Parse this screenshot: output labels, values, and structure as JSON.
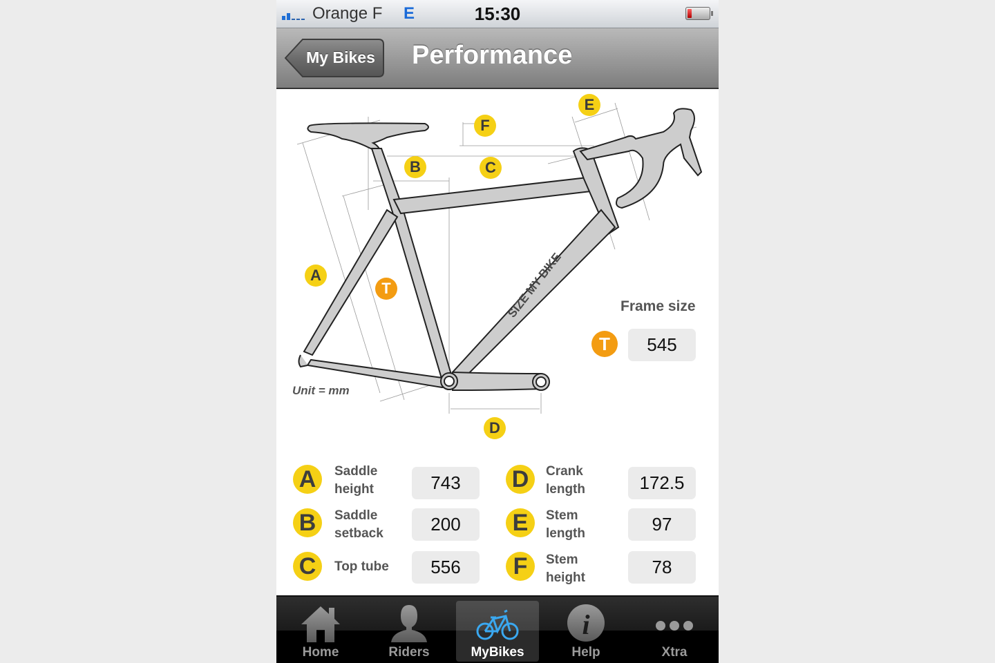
{
  "status_bar": {
    "carrier": "Orange F",
    "network": "E",
    "time": "15:30",
    "signal_bars_active": 2,
    "signal_bars_total": 5,
    "battery_level": 0.2
  },
  "nav": {
    "back_label": "My Bikes",
    "title": "Performance"
  },
  "diagram": {
    "brand_text": "SIZE MY BIKE",
    "unit_label": "Unit = mm",
    "markers": [
      "A",
      "B",
      "C",
      "D",
      "E",
      "F",
      "T"
    ],
    "frame_size_label": "Frame size",
    "frame_size_badge": "T",
    "frame_size_value": "545"
  },
  "measurements": [
    {
      "letter": "A",
      "label": "Saddle\nheight",
      "value": "743"
    },
    {
      "letter": "B",
      "label": "Saddle\nsetback",
      "value": "200"
    },
    {
      "letter": "C",
      "label": "Top tube",
      "value": "556"
    },
    {
      "letter": "D",
      "label": "Crank\nlength",
      "value": "172.5"
    },
    {
      "letter": "E",
      "label": "Stem\nlength",
      "value": "97"
    },
    {
      "letter": "F",
      "label": "Stem\nheight",
      "value": "78"
    }
  ],
  "tabs": [
    {
      "label": "Home",
      "icon": "home-icon",
      "active": false
    },
    {
      "label": "Riders",
      "icon": "rider-icon",
      "active": false
    },
    {
      "label": "MyBikes",
      "icon": "bike-icon",
      "active": true
    },
    {
      "label": "Help",
      "icon": "info-icon",
      "active": false
    },
    {
      "label": "Xtra",
      "icon": "more-icon",
      "active": false
    }
  ],
  "colors": {
    "badge_yellow": "#f5d015",
    "badge_orange": "#f39c12",
    "active_bike_icon": "#3aa8f0"
  }
}
